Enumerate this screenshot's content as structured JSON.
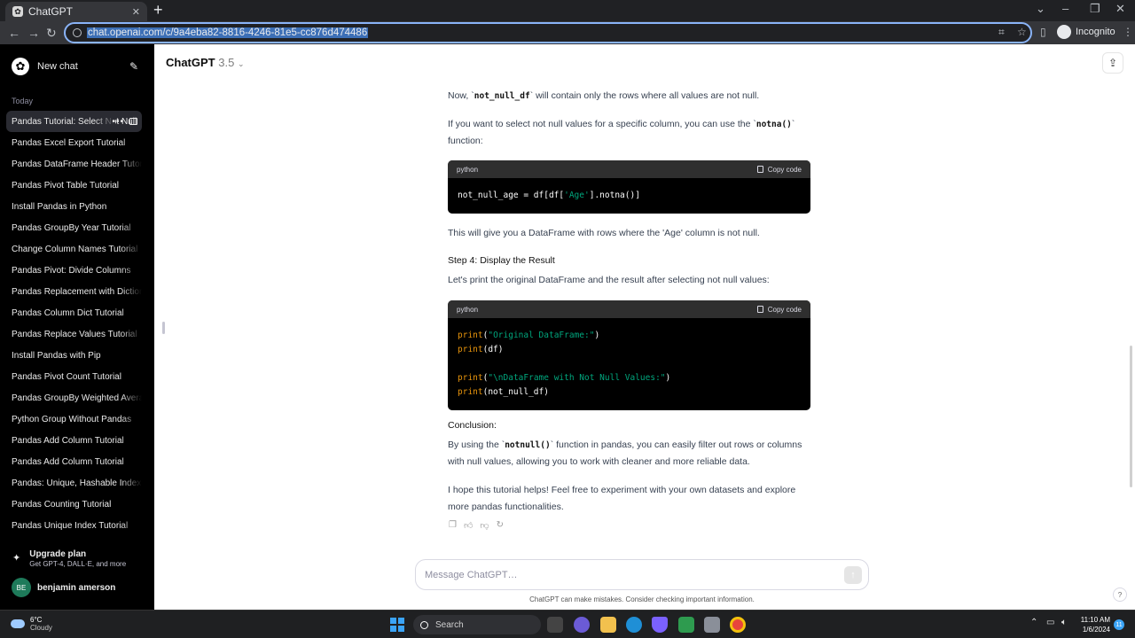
{
  "browser": {
    "tab_title": "ChatGPT",
    "favicon_glyph": "✿",
    "url": "chat.openai.com/c/9a4eba82-8816-4246-81e5-cc876d474486",
    "incognito_label": "Incognito"
  },
  "sidebar": {
    "new_chat": "New chat",
    "section_today": "Today",
    "items": [
      {
        "label": "Pandas Tutorial: Select Not Null"
      },
      {
        "label": "Pandas Excel Export Tutorial"
      },
      {
        "label": "Pandas DataFrame Header Tutorial"
      },
      {
        "label": "Pandas Pivot Table Tutorial"
      },
      {
        "label": "Install Pandas in Python"
      },
      {
        "label": "Pandas GroupBy Year Tutorial"
      },
      {
        "label": "Change Column Names Tutorial"
      },
      {
        "label": "Pandas Pivot: Divide Columns"
      },
      {
        "label": "Pandas Replacement with Dictionary"
      },
      {
        "label": "Pandas Column Dict Tutorial"
      },
      {
        "label": "Pandas Replace Values Tutorial"
      },
      {
        "label": "Install Pandas with Pip"
      },
      {
        "label": "Pandas Pivot Count Tutorial"
      },
      {
        "label": "Pandas GroupBy Weighted Average"
      },
      {
        "label": "Python Group Without Pandas"
      },
      {
        "label": "Pandas Add Column Tutorial"
      },
      {
        "label": "Pandas Add Column Tutorial"
      },
      {
        "label": "Pandas: Unique, Hashable Index"
      },
      {
        "label": "Pandas Counting Tutorial"
      },
      {
        "label": "Pandas Unique Index Tutorial"
      }
    ],
    "upgrade_title": "Upgrade plan",
    "upgrade_sub": "Get GPT-4, DALL·E, and more",
    "user_initials": "BE",
    "user_name": "benjamin amerson"
  },
  "header": {
    "model_name": "ChatGPT",
    "model_version": "3.5"
  },
  "message": {
    "p1_a": "Now, `",
    "p1_code": "not_null_df",
    "p1_b": "` will contain only the rows where all values are not null.",
    "p2_a": "If you want to select not null values for a specific column, you can use the `",
    "p2_code": "notna()",
    "p2_b": "` function:",
    "code1_lang": "python",
    "code1_copy": "Copy code",
    "code1_l1_a": "not_null_age = df[df[",
    "code1_l1_str": "'Age'",
    "code1_l1_b": "].notna()]",
    "p3": "This will give you a DataFrame with rows where the 'Age' column is not null.",
    "h_step4": "Step 4: Display the Result",
    "p4": "Let's print the original DataFrame and the result after selecting not null values:",
    "code2_lang": "python",
    "code2_copy": "Copy code",
    "code2_kw": "print",
    "code2_l1_str": "\"Original DataFrame:\"",
    "code2_l2_arg": "(df)",
    "code2_l3_str": "\"\\nDataFrame with Not Null Values:\"",
    "code2_l4_arg": "(not_null_df)",
    "h_conclusion": "Conclusion:",
    "p5_a": "By using the `",
    "p5_code": "notnull()",
    "p5_b": "` function in pandas, you can easily filter out rows or columns with null values, allowing you to work with cleaner and more reliable data.",
    "p6": "I hope this tutorial helps! Feel free to experiment with your own datasets and explore more pandas functionalities."
  },
  "composer": {
    "placeholder": "Message ChatGPT…",
    "disclaimer": "ChatGPT can make mistakes. Consider checking important information.",
    "help": "?"
  },
  "taskbar": {
    "temp": "6°C",
    "condition": "Cloudy",
    "search_label": "Search",
    "time": "11:10 AM",
    "date": "1/6/2024",
    "notif_count": "11"
  }
}
